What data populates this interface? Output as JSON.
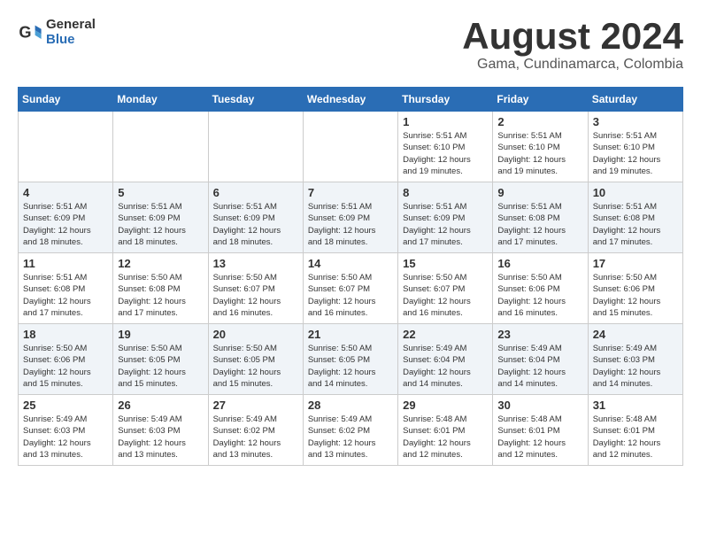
{
  "header": {
    "logo_general": "General",
    "logo_blue": "Blue",
    "month_year": "August 2024",
    "location": "Gama, Cundinamarca, Colombia"
  },
  "weekdays": [
    "Sunday",
    "Monday",
    "Tuesday",
    "Wednesday",
    "Thursday",
    "Friday",
    "Saturday"
  ],
  "weeks": [
    [
      {
        "day": "",
        "info": ""
      },
      {
        "day": "",
        "info": ""
      },
      {
        "day": "",
        "info": ""
      },
      {
        "day": "",
        "info": ""
      },
      {
        "day": "1",
        "info": "Sunrise: 5:51 AM\nSunset: 6:10 PM\nDaylight: 12 hours\nand 19 minutes."
      },
      {
        "day": "2",
        "info": "Sunrise: 5:51 AM\nSunset: 6:10 PM\nDaylight: 12 hours\nand 19 minutes."
      },
      {
        "day": "3",
        "info": "Sunrise: 5:51 AM\nSunset: 6:10 PM\nDaylight: 12 hours\nand 19 minutes."
      }
    ],
    [
      {
        "day": "4",
        "info": "Sunrise: 5:51 AM\nSunset: 6:09 PM\nDaylight: 12 hours\nand 18 minutes."
      },
      {
        "day": "5",
        "info": "Sunrise: 5:51 AM\nSunset: 6:09 PM\nDaylight: 12 hours\nand 18 minutes."
      },
      {
        "day": "6",
        "info": "Sunrise: 5:51 AM\nSunset: 6:09 PM\nDaylight: 12 hours\nand 18 minutes."
      },
      {
        "day": "7",
        "info": "Sunrise: 5:51 AM\nSunset: 6:09 PM\nDaylight: 12 hours\nand 18 minutes."
      },
      {
        "day": "8",
        "info": "Sunrise: 5:51 AM\nSunset: 6:09 PM\nDaylight: 12 hours\nand 17 minutes."
      },
      {
        "day": "9",
        "info": "Sunrise: 5:51 AM\nSunset: 6:08 PM\nDaylight: 12 hours\nand 17 minutes."
      },
      {
        "day": "10",
        "info": "Sunrise: 5:51 AM\nSunset: 6:08 PM\nDaylight: 12 hours\nand 17 minutes."
      }
    ],
    [
      {
        "day": "11",
        "info": "Sunrise: 5:51 AM\nSunset: 6:08 PM\nDaylight: 12 hours\nand 17 minutes."
      },
      {
        "day": "12",
        "info": "Sunrise: 5:50 AM\nSunset: 6:08 PM\nDaylight: 12 hours\nand 17 minutes."
      },
      {
        "day": "13",
        "info": "Sunrise: 5:50 AM\nSunset: 6:07 PM\nDaylight: 12 hours\nand 16 minutes."
      },
      {
        "day": "14",
        "info": "Sunrise: 5:50 AM\nSunset: 6:07 PM\nDaylight: 12 hours\nand 16 minutes."
      },
      {
        "day": "15",
        "info": "Sunrise: 5:50 AM\nSunset: 6:07 PM\nDaylight: 12 hours\nand 16 minutes."
      },
      {
        "day": "16",
        "info": "Sunrise: 5:50 AM\nSunset: 6:06 PM\nDaylight: 12 hours\nand 16 minutes."
      },
      {
        "day": "17",
        "info": "Sunrise: 5:50 AM\nSunset: 6:06 PM\nDaylight: 12 hours\nand 15 minutes."
      }
    ],
    [
      {
        "day": "18",
        "info": "Sunrise: 5:50 AM\nSunset: 6:06 PM\nDaylight: 12 hours\nand 15 minutes."
      },
      {
        "day": "19",
        "info": "Sunrise: 5:50 AM\nSunset: 6:05 PM\nDaylight: 12 hours\nand 15 minutes."
      },
      {
        "day": "20",
        "info": "Sunrise: 5:50 AM\nSunset: 6:05 PM\nDaylight: 12 hours\nand 15 minutes."
      },
      {
        "day": "21",
        "info": "Sunrise: 5:50 AM\nSunset: 6:05 PM\nDaylight: 12 hours\nand 14 minutes."
      },
      {
        "day": "22",
        "info": "Sunrise: 5:49 AM\nSunset: 6:04 PM\nDaylight: 12 hours\nand 14 minutes."
      },
      {
        "day": "23",
        "info": "Sunrise: 5:49 AM\nSunset: 6:04 PM\nDaylight: 12 hours\nand 14 minutes."
      },
      {
        "day": "24",
        "info": "Sunrise: 5:49 AM\nSunset: 6:03 PM\nDaylight: 12 hours\nand 14 minutes."
      }
    ],
    [
      {
        "day": "25",
        "info": "Sunrise: 5:49 AM\nSunset: 6:03 PM\nDaylight: 12 hours\nand 13 minutes."
      },
      {
        "day": "26",
        "info": "Sunrise: 5:49 AM\nSunset: 6:03 PM\nDaylight: 12 hours\nand 13 minutes."
      },
      {
        "day": "27",
        "info": "Sunrise: 5:49 AM\nSunset: 6:02 PM\nDaylight: 12 hours\nand 13 minutes."
      },
      {
        "day": "28",
        "info": "Sunrise: 5:49 AM\nSunset: 6:02 PM\nDaylight: 12 hours\nand 13 minutes."
      },
      {
        "day": "29",
        "info": "Sunrise: 5:48 AM\nSunset: 6:01 PM\nDaylight: 12 hours\nand 12 minutes."
      },
      {
        "day": "30",
        "info": "Sunrise: 5:48 AM\nSunset: 6:01 PM\nDaylight: 12 hours\nand 12 minutes."
      },
      {
        "day": "31",
        "info": "Sunrise: 5:48 AM\nSunset: 6:01 PM\nDaylight: 12 hours\nand 12 minutes."
      }
    ]
  ]
}
